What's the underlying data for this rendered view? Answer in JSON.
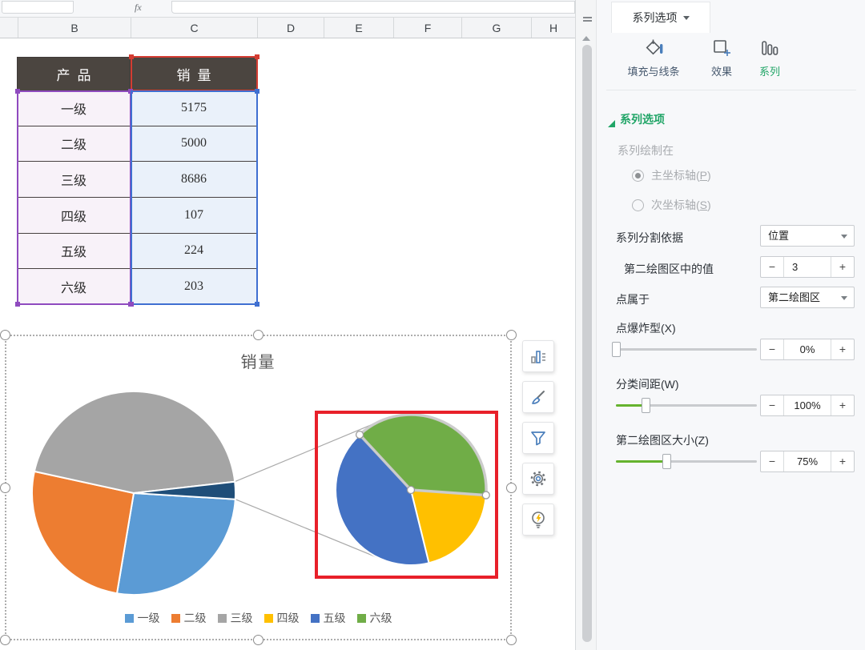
{
  "formula_bar": {
    "fx": "fx"
  },
  "columns": [
    "B",
    "C",
    "D",
    "E",
    "F",
    "G",
    "H"
  ],
  "table": {
    "headers": [
      "产品",
      "销量"
    ],
    "rows": [
      [
        "一级",
        "5175"
      ],
      [
        "二级",
        "5000"
      ],
      [
        "三级",
        "8686"
      ],
      [
        "四级",
        "107"
      ],
      [
        "五级",
        "224"
      ],
      [
        "六级",
        "203"
      ]
    ]
  },
  "chart_data": {
    "type": "pie",
    "subtype": "pie_of_pie",
    "title": "销量",
    "categories": [
      "一级",
      "二级",
      "三级",
      "四级",
      "五级",
      "六级"
    ],
    "values": [
      5175,
      5000,
      8686,
      107,
      224,
      203
    ],
    "colors": [
      "#5B9BD5",
      "#ED7D31",
      "#A5A5A5",
      "#FFC000",
      "#4472C4",
      "#70AD47"
    ],
    "other_slice_color": "#1F4E79",
    "secondary_plot_count": 3,
    "selected_point": "六级",
    "legend_position": "bottom",
    "layout": {
      "main_start_deg": 93.46,
      "secondary_start_deg": 94.0
    }
  },
  "chart_toolbar": [
    "chart-elements",
    "chart-style",
    "chart-filter",
    "chart-settings",
    "chart-ideas"
  ],
  "sidebar": {
    "tab": "系列选项",
    "format_tabs": [
      {
        "label": "填充与线条",
        "active": false
      },
      {
        "label": "效果",
        "active": false
      },
      {
        "label": "系列",
        "active": true
      }
    ],
    "section_title": "系列选项",
    "plot_on": {
      "label": "系列绘制在",
      "options": [
        {
          "pre": "主坐标轴(",
          "key": "P",
          "post": ")",
          "selected": true
        },
        {
          "pre": "次坐标轴(",
          "key": "S",
          "post": ")",
          "selected": false
        }
      ]
    },
    "split_by": {
      "label": "系列分割依据",
      "value": "位置"
    },
    "second_plot_values": {
      "label": "第二绘图区中的值",
      "value": "3"
    },
    "point_belongs": {
      "label": "点属于",
      "value": "第二绘图区"
    },
    "explosion": {
      "label": "点爆炸型(X)",
      "value": "0%",
      "thumb_pct": 0
    },
    "gap_width": {
      "label": "分类间距(W)",
      "value": "100%",
      "thumb_pct": 21
    },
    "second_plot_size": {
      "label": "第二绘图区大小(Z)",
      "value": "75%",
      "thumb_pct": 36
    },
    "stepper_minus": "−",
    "stepper_plus": "+"
  }
}
